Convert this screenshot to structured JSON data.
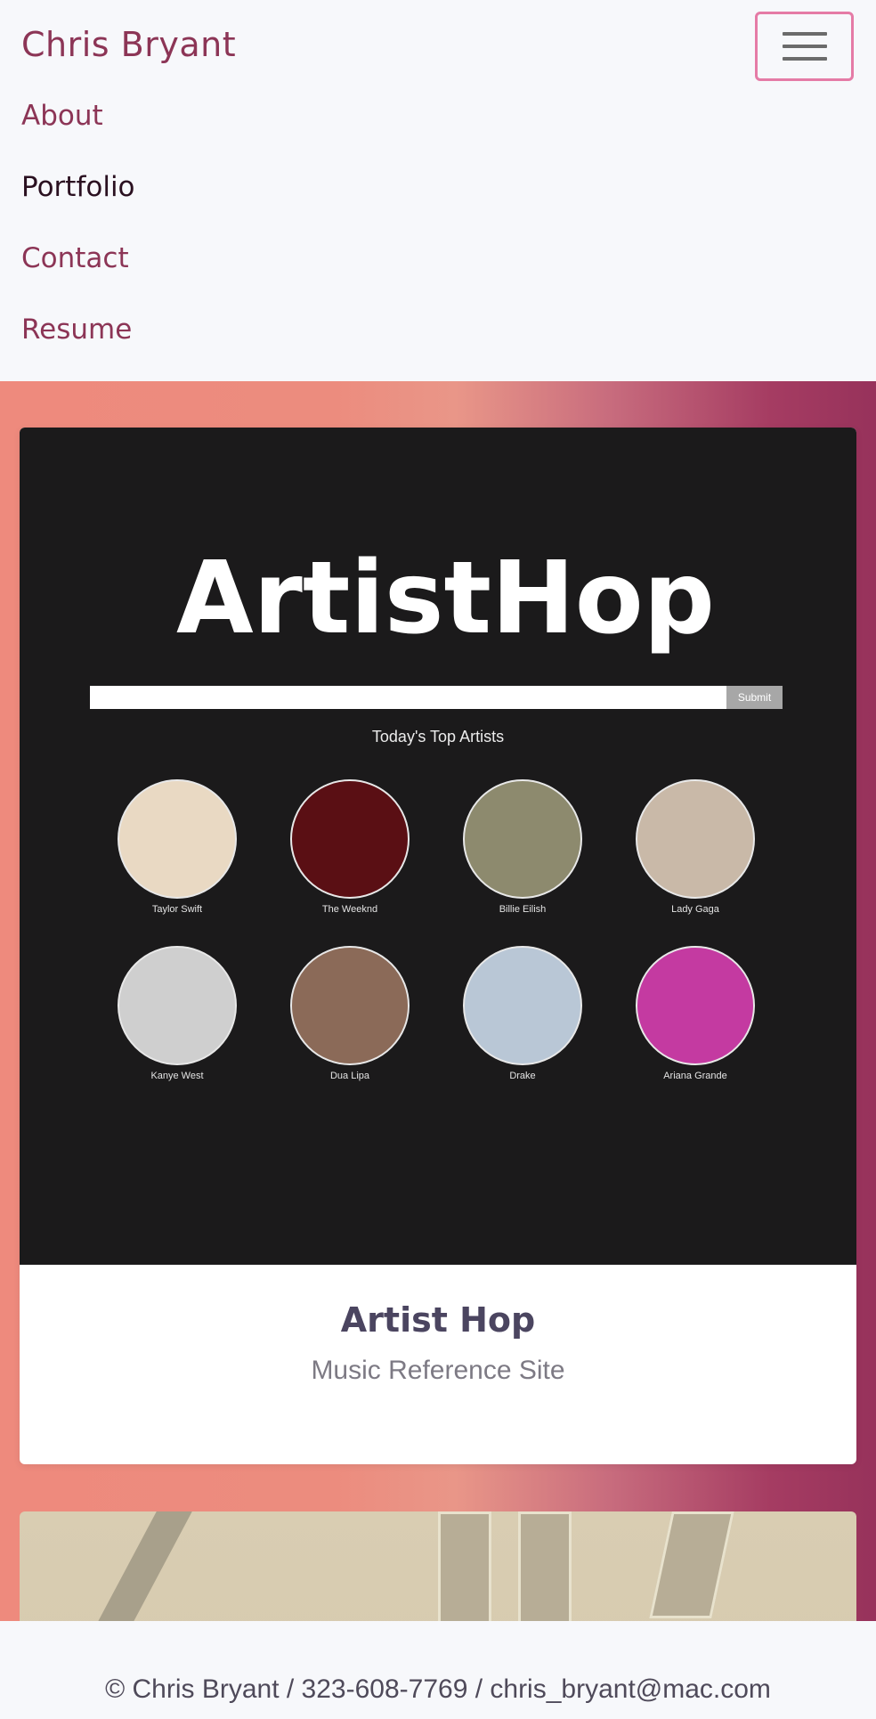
{
  "navbar": {
    "brand": "Chris Bryant",
    "toggler_icon": "hamburger-icon",
    "items": [
      {
        "label": "About",
        "active": false
      },
      {
        "label": "Portfolio",
        "active": true
      },
      {
        "label": "Contact",
        "active": false
      },
      {
        "label": "Resume",
        "active": false
      }
    ]
  },
  "colors": {
    "brand": "#8c3556",
    "gradient_start": "#ee8a7d",
    "gradient_end": "#97325b",
    "toggler_border": "#e57ba6"
  },
  "project": {
    "title": "Artist Hop",
    "subtitle": "Music Reference Site",
    "screenshot": {
      "logo_text": "ArtistHop",
      "submit_label": "Submit",
      "heading": "Today's Top Artists",
      "artists": [
        {
          "name": "Taylor Swift",
          "color": "#e9d9c3"
        },
        {
          "name": "The Weeknd",
          "color": "#5a0f14"
        },
        {
          "name": "Billie Eilish",
          "color": "#8d8a6e"
        },
        {
          "name": "Lady Gaga",
          "color": "#c9b9a8"
        },
        {
          "name": "Kanye West",
          "color": "#cfcfcf"
        },
        {
          "name": "Dua Lipa",
          "color": "#8b6a58"
        },
        {
          "name": "Drake",
          "color": "#b9c7d6"
        },
        {
          "name": "Ariana Grande",
          "color": "#c43aa1"
        }
      ]
    }
  },
  "footer": {
    "text": "© Chris Bryant / 323-608-7769 / chris_bryant@mac.com"
  }
}
